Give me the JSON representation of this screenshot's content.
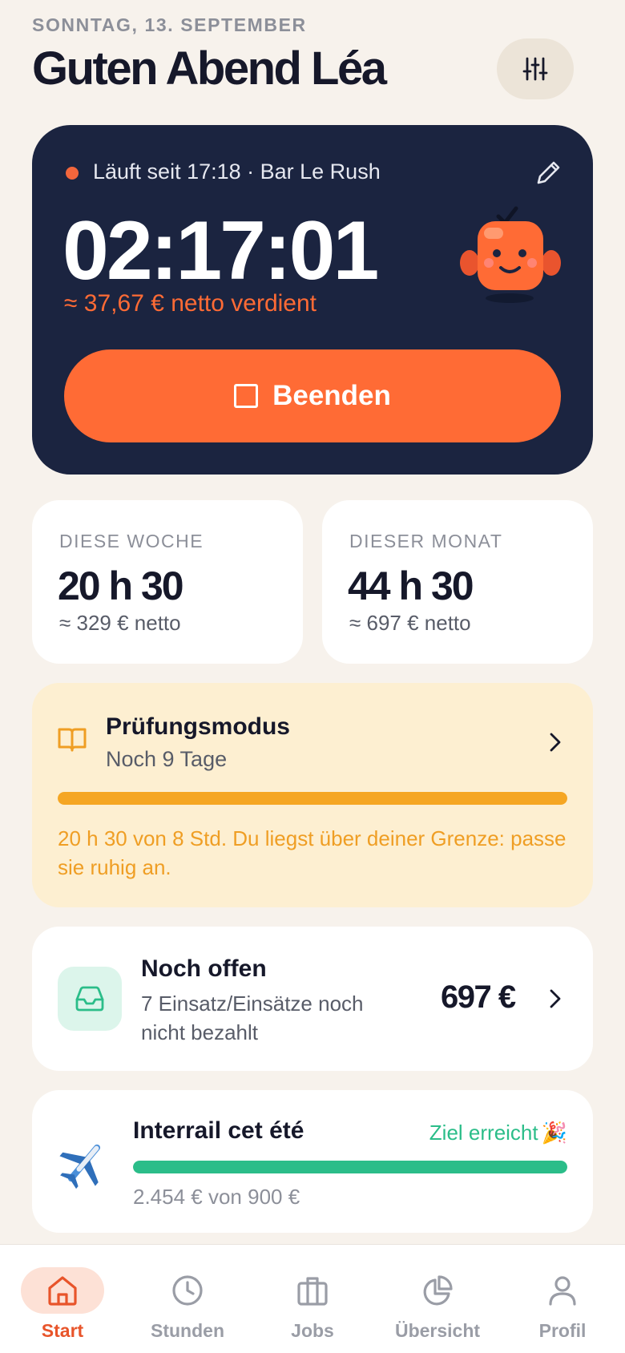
{
  "header": {
    "date": "SONNTAG, 13. SEPTEMBER",
    "greeting": "Guten Abend Léa",
    "settings_icon": "sliders-icon"
  },
  "timer": {
    "status": "Läuft seit 17:18 · Bar Le Rush",
    "elapsed": "02:17:01",
    "earned": "≈ 37,67 € netto verdient",
    "stop_label": "Beenden",
    "accent_color": "#ff6b35",
    "card_color": "#1b2440"
  },
  "stats": {
    "week": {
      "label": "DIESE WOCHE",
      "value": "20 h 30",
      "sub": "≈ 329 € netto"
    },
    "month": {
      "label": "DIESER MONAT",
      "value": "44 h 30",
      "sub": "≈ 697 € netto"
    }
  },
  "exam_mode": {
    "title": "Prüfungsmodus",
    "subtitle": "Noch 9 Tage",
    "progress_fraction": 1.0,
    "warning": "20 h 30 von 8 Std. Du liegst über deiner Grenze: passe sie ruhig an.",
    "icon": "book-icon"
  },
  "open_payments": {
    "title": "Noch offen",
    "subtitle": "7 Einsatz/Einsätze noch nicht bezahlt",
    "amount": "697 €",
    "icon": "inbox-icon"
  },
  "goal": {
    "title": "Interrail cet été",
    "status": "Ziel erreicht",
    "status_emoji": "🎉",
    "progress_fraction": 1.0,
    "amount": "2.454 € von 900 €",
    "icon": "airplane-icon"
  },
  "nav": {
    "items": [
      {
        "label": "Start",
        "icon": "home-icon",
        "active": true
      },
      {
        "label": "Stunden",
        "icon": "clock-icon",
        "active": false
      },
      {
        "label": "Jobs",
        "icon": "briefcase-icon",
        "active": false
      },
      {
        "label": "Übersicht",
        "icon": "pie-chart-icon",
        "active": false
      },
      {
        "label": "Profil",
        "icon": "user-icon",
        "active": false
      }
    ]
  }
}
